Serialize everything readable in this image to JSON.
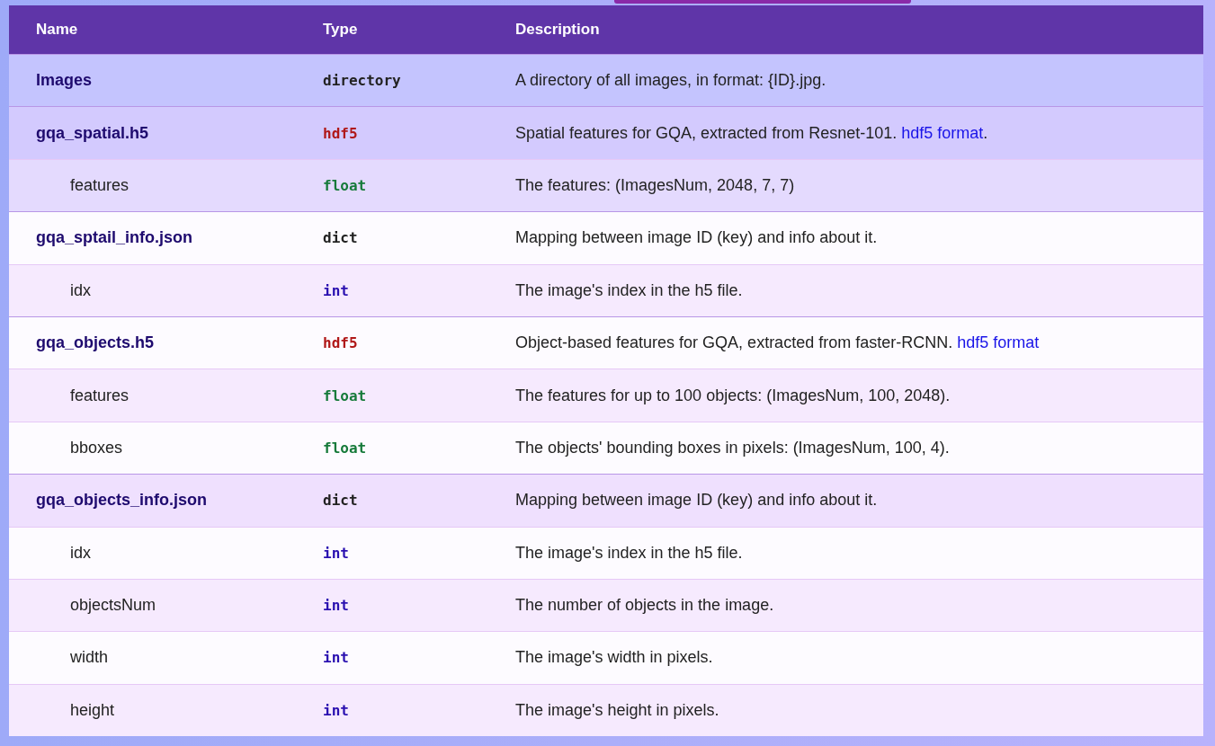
{
  "table": {
    "columns": [
      "Name",
      "Type",
      "Description"
    ],
    "rows": [
      {
        "name": "Images",
        "type": {
          "text": "directory",
          "color": "#222222"
        },
        "color": "#c4c4fe",
        "description": "A directory of all images, in format: {ID}.jpg."
      },
      {
        "name": "gqa_spatial.h5",
        "type": {
          "text": "hdf5",
          "color": "#b01818"
        },
        "color": "#d3cafe",
        "description": "Spatial features for GQA, extracted from Resnet-101.",
        "link": "hdf5 format",
        "link_suffix": ".",
        "children": [
          {
            "name": "features",
            "type": {
              "text": "float",
              "color": "#167a3a"
            },
            "color": "#e4dafe",
            "description": "The features: (ImagesNum, 2048, 7, 7)"
          }
        ]
      },
      {
        "name": "gqa_sptail_info.json",
        "type": {
          "text": "dict",
          "color": "#222222"
        },
        "color": "#fdfbff",
        "description": "Mapping between image ID (key) and info about it.",
        "children": [
          {
            "name": "idx",
            "type": {
              "text": "int",
              "color": "#2a10b0"
            },
            "color": "#f6eafe",
            "description": "The image's index in the h5 file."
          }
        ]
      },
      {
        "name": "gqa_objects.h5",
        "type": {
          "text": "hdf5",
          "color": "#b01818"
        },
        "color": "#fdfbff",
        "description": "Object-based features for GQA, extracted from faster-RCNN.",
        "link": "hdf5 format",
        "children": [
          {
            "name": "features",
            "type": {
              "text": "float",
              "color": "#167a3a"
            },
            "color": "#f6eafe",
            "description": "The features for up to 100 objects: (ImagesNum, 100, 2048)."
          },
          {
            "name": "bboxes",
            "type": {
              "text": "float",
              "color": "#167a3a"
            },
            "color": "#fdfbff",
            "description": "The objects' bounding boxes in pixels: (ImagesNum, 100, 4)."
          }
        ]
      },
      {
        "name": "gqa_objects_info.json",
        "type": {
          "text": "dict",
          "color": "#222222"
        },
        "color": "#efe0fe",
        "description": "Mapping between image ID (key) and info about it.",
        "children": [
          {
            "name": "idx",
            "type": {
              "text": "int",
              "color": "#2a10b0"
            },
            "color": "#fdfbff",
            "description": "The image's index in the h5 file."
          },
          {
            "name": "objectsNum",
            "type": {
              "text": "int",
              "color": "#2a10b0"
            },
            "color": "#f6eafe",
            "description": "The number of objects in the image."
          },
          {
            "name": "width",
            "type": {
              "text": "int",
              "color": "#2a10b0"
            },
            "color": "#fdfbff",
            "description": "The image's width in pixels."
          },
          {
            "name": "height",
            "type": {
              "text": "int",
              "color": "#2a10b0"
            },
            "color": "#f6eafe",
            "description": "The image's height in pixels."
          }
        ]
      }
    ]
  }
}
